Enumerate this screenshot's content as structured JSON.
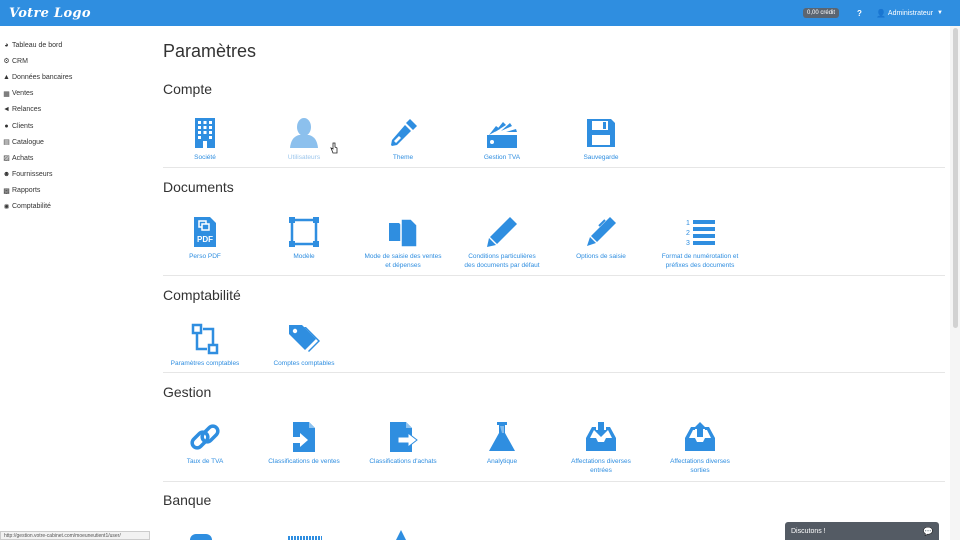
{
  "header": {
    "logo": "Votre Logo",
    "credit": "0,00 crédit",
    "help": "?",
    "user": "Administrateur"
  },
  "sidebar": {
    "items": [
      {
        "label": "Tableau de bord",
        "icon": "dashboard-icon"
      },
      {
        "label": "CRM",
        "icon": "gear-icon"
      },
      {
        "label": "Données bancaires",
        "icon": "bank-icon"
      },
      {
        "label": "Ventes",
        "icon": "sales-icon"
      },
      {
        "label": "Relances",
        "icon": "megaphone-icon"
      },
      {
        "label": "Clients",
        "icon": "users-icon"
      },
      {
        "label": "Catalogue",
        "icon": "catalog-icon"
      },
      {
        "label": "Achats",
        "icon": "basket-icon"
      },
      {
        "label": "Fournisseurs",
        "icon": "user-icon"
      },
      {
        "label": "Rapports",
        "icon": "chart-icon"
      },
      {
        "label": "Comptabilité",
        "icon": "tools-icon"
      }
    ]
  },
  "status_url": "http://gestion.votre-cabinet.com/moeuneutient1/user/",
  "main": {
    "title": "Paramètres",
    "sections": {
      "compte": {
        "title": "Compte",
        "tiles": [
          "Société",
          "Utilisateurs",
          "Theme",
          "Gestion TVA",
          "Sauvegarde"
        ]
      },
      "documents": {
        "title": "Documents",
        "tiles": [
          "Perso PDF",
          "Modèle",
          [
            "Mode de saisie des ventes",
            "et dépenses"
          ],
          [
            "Conditions particulières",
            "des documents par défaut"
          ],
          "Options de saisie",
          [
            "Format de numérotation et",
            "préfixes des documents"
          ]
        ]
      },
      "comptabilite": {
        "title": "Comptabilité",
        "tiles": [
          "Paramètres comptables",
          "Comptes comptables"
        ]
      },
      "gestion": {
        "title": "Gestion",
        "tiles": [
          "Taux de TVA",
          "Classifications de ventes",
          "Classifications d'achats",
          "Analytique",
          [
            "Affectations diverses",
            "entrées"
          ],
          [
            "Affectations diverses",
            "sorties"
          ]
        ]
      },
      "banque": {
        "title": "Banque"
      }
    }
  },
  "chat": {
    "label": "Discutons !"
  },
  "colors": {
    "accent": "#2f8ee0",
    "chat_bg": "#545b64"
  }
}
